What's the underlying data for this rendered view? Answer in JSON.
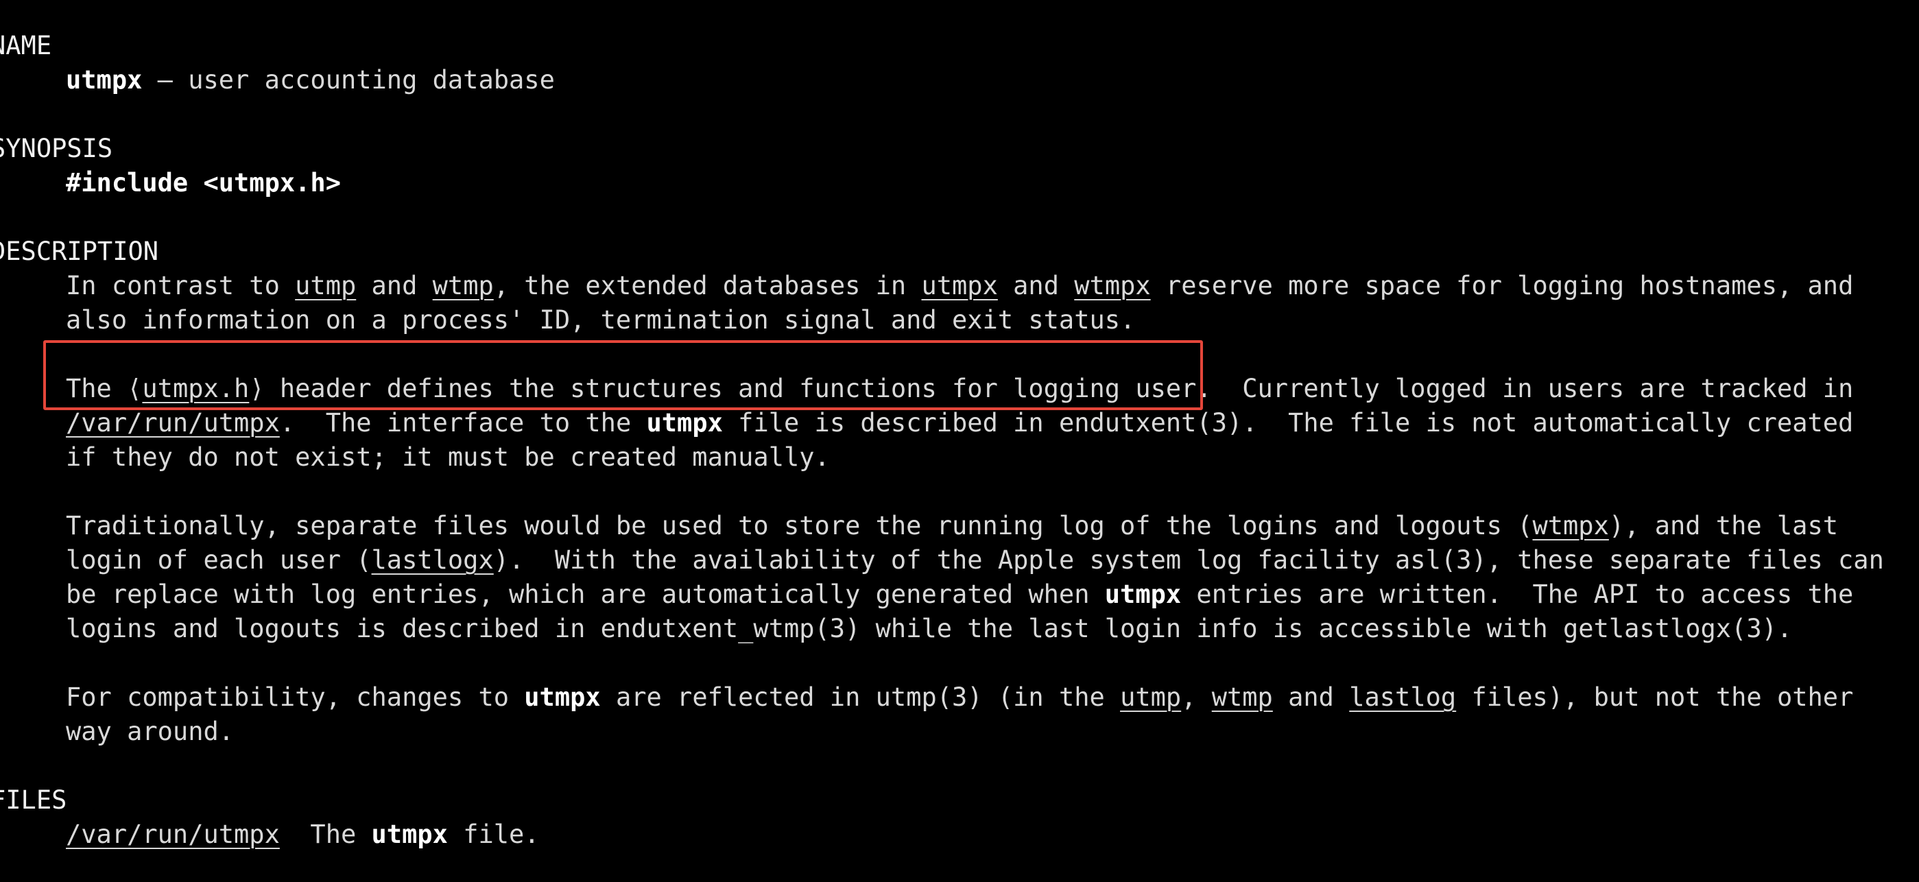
{
  "colors": {
    "background": "#000000",
    "text": "#d9d9d9",
    "bold_text": "#ffffff",
    "annotation_box": "#e4463a"
  },
  "sections": {
    "name": {
      "heading": "NAME",
      "cmd": "utmpx",
      "desc": " – user accounting database"
    },
    "synopsis": {
      "heading": "SYNOPSIS",
      "include": "#include <utmpx.h>"
    },
    "description": {
      "heading": "DESCRIPTION",
      "p1": {
        "l1": [
          "In contrast to ",
          "utmp",
          " and ",
          "wtmp",
          ", the extended databases in ",
          "utmpx",
          " and ",
          "wtmpx",
          " reserve more space for logging hostnames, and"
        ],
        "l2": "also information on a process' ID, termination signal and exit status."
      },
      "p2": {
        "l1": [
          "The ⟨",
          "utmpx.h",
          "⟩ header defines the structures and functions for logging user.  Currently logged in users are tracked in"
        ],
        "l2": [
          "/var/run/utmpx",
          ".  The interface to the ",
          "utmpx",
          " file is described in endutxent(3).  The file is not automatically created"
        ],
        "l3": "if they do not exist; it must be created manually."
      },
      "p3": {
        "l1": [
          "Traditionally, separate files would be used to store the running log of the logins and logouts (",
          "wtmpx",
          "), and the last"
        ],
        "l2": [
          "login of each user (",
          "lastlogx",
          ").  With the availability of the Apple system log facility asl(3), these separate files can"
        ],
        "l3": [
          "be replace with log entries, which are automatically generated when ",
          "utmpx",
          " entries are written.  The API to access the"
        ],
        "l4": "logins and logouts is described in endutxent_wtmp(3) while the last login info is accessible with getlastlogx(3)."
      },
      "p4": {
        "l1": [
          "For compatibility, changes to ",
          "utmpx",
          " are reflected in utmp(3) (in the ",
          "utmp",
          ", ",
          "wtmp",
          " and ",
          "lastlog",
          " files), but not the other"
        ],
        "l2": "way around."
      }
    },
    "files": {
      "heading": "FILES",
      "l1": [
        "/var/run/utmpx",
        "  The ",
        "utmpx",
        " file."
      ]
    }
  }
}
